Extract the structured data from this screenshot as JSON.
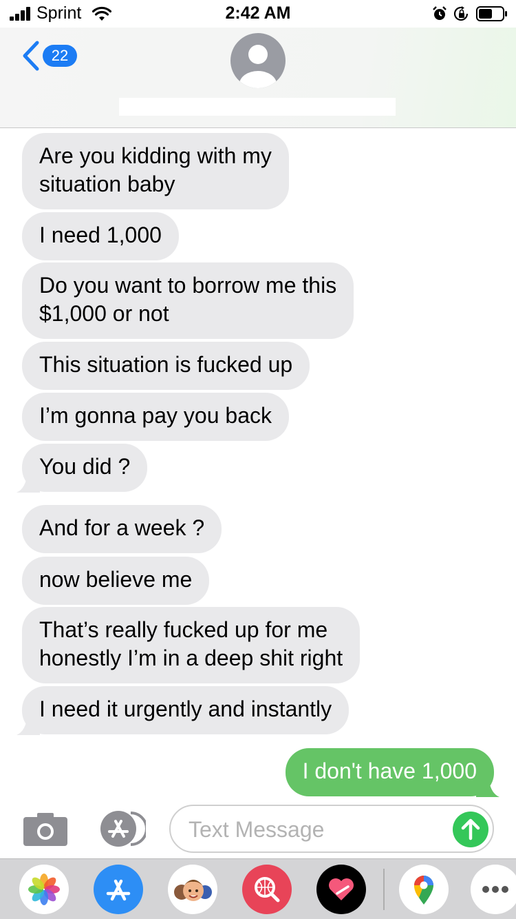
{
  "status_bar": {
    "carrier": "Sprint",
    "time": "2:42 AM",
    "signal_bars": 4,
    "icons": [
      "signal-icon",
      "wifi-icon",
      "alarm-icon",
      "orientation-lock-icon",
      "battery-icon"
    ],
    "battery_level": 0.55
  },
  "header": {
    "back_badge": "22",
    "contact_name": ""
  },
  "messages": [
    {
      "direction": "in",
      "text": "Are you kidding with my\nsituation baby"
    },
    {
      "direction": "in",
      "text": "I need 1,000"
    },
    {
      "direction": "in",
      "text": "Do you want to borrow me this\n$1,000 or not"
    },
    {
      "direction": "in",
      "text": "This situation is fucked up"
    },
    {
      "direction": "in",
      "text": "I’m gonna pay you back"
    },
    {
      "direction": "in",
      "text": "You did ?"
    },
    {
      "direction": "in",
      "text": "And for a week ?"
    },
    {
      "direction": "in",
      "text": "now believe me"
    },
    {
      "direction": "in",
      "text": "That’s really fucked up for me\nhonestly I’m in a deep shit right"
    },
    {
      "direction": "in",
      "text": "I need it urgently and instantly"
    },
    {
      "direction": "out",
      "text": "I don't have 1,000"
    }
  ],
  "composer": {
    "placeholder": "Text Message",
    "value": ""
  },
  "app_drawer": {
    "apps": [
      "photos-app-icon",
      "app-store-app-icon",
      "memoji-app-icon",
      "search-images-app-icon",
      "digital-touch-app-icon",
      "google-maps-app-icon",
      "more-apps-icon"
    ]
  },
  "colors": {
    "incoming_bubble": "#e9e9eb",
    "outgoing_bubble": "#65c466",
    "badge": "#1c7cf4",
    "send": "#34c759"
  }
}
